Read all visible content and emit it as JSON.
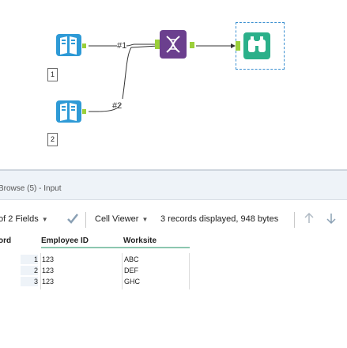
{
  "workflow": {
    "inputs": [
      {
        "badge": "1",
        "connection_label": "#1"
      },
      {
        "badge": "2",
        "connection_label": "#2"
      }
    ],
    "colors": {
      "input_tool": "#2e9ad6",
      "join_tool": "#6b3f8e",
      "browse_tool": "#2bb08a",
      "connector_anchor": "#9bcf3a",
      "connection_line": "#333333",
      "selection_border": "#3a8fd0"
    },
    "icons": [
      "input-data-icon",
      "join-multiple-icon",
      "browse-binoculars-icon"
    ]
  },
  "results": {
    "title": "Browse (5) - Input",
    "toolbar": {
      "fields_label": "of 2 Fields",
      "cell_viewer_label": "Cell Viewer",
      "status_text": "3 records displayed, 948 bytes"
    },
    "columns": [
      "ord",
      "Employee ID",
      "Worksite"
    ],
    "rows": [
      {
        "num": "1",
        "employee_id": "123",
        "worksite": "ABC"
      },
      {
        "num": "2",
        "employee_id": "123",
        "worksite": "DEF"
      },
      {
        "num": "3",
        "employee_id": "123",
        "worksite": "GHC"
      }
    ],
    "colors": {
      "header_underline": "#8cc7b0",
      "rownum_bg": "#eef3f8",
      "title_bar_bg": "#eef3f8"
    }
  }
}
